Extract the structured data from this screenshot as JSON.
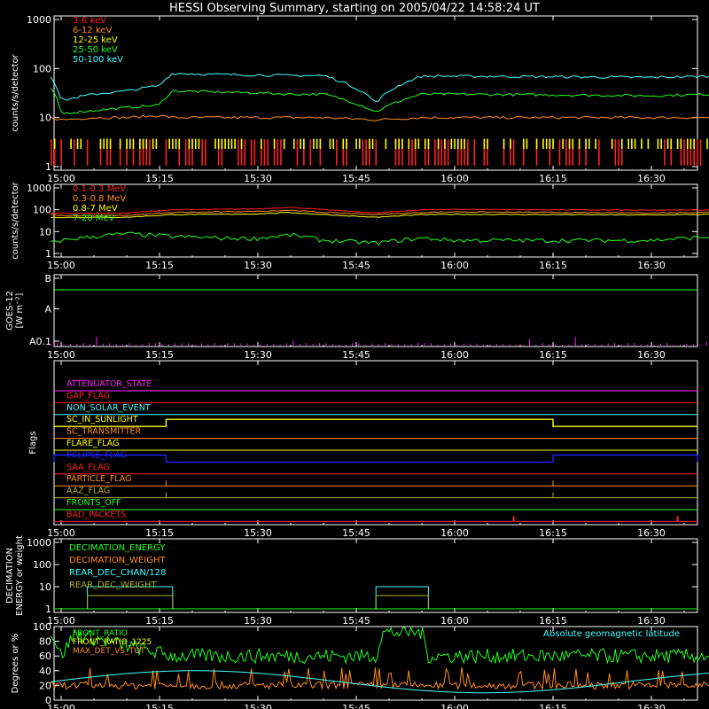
{
  "title": "HESSI Observing Summary, starting on 2005/04/22 14:58:24 UT",
  "time_ticks": [
    "15:00",
    "15:15",
    "15:30",
    "15:45",
    "16:00",
    "16:15",
    "16:30"
  ],
  "colors": {
    "red": "#ff2020",
    "orange": "#ff8c1a",
    "yellow": "#ffff00",
    "green": "#20ff20",
    "cyan": "#40ffff",
    "magenta": "#ff20ff",
    "blue": "#2020ff",
    "olive": "#b0b020",
    "axis": "#ffffff",
    "background": "#000000"
  },
  "chart_data": [
    {
      "id": "low-energy",
      "type": "line",
      "ylabel": "counts/s/detector",
      "scale": "log",
      "yticks": [
        "1",
        "10",
        "100",
        "1000"
      ],
      "legend_placement": "top-left",
      "x": [
        "14:58:24",
        "15:00",
        "15:05",
        "15:10",
        "15:15",
        "15:17",
        "15:25",
        "15:30",
        "15:35",
        "15:40",
        "15:48",
        "15:55",
        "16:00",
        "16:15",
        "16:30",
        "16:40"
      ],
      "series": [
        {
          "name": "3-6 keV",
          "color": "red",
          "values": [
            1.6,
            1.6,
            1.5,
            1.6,
            1.7,
            1.5,
            1.6,
            1.5,
            1.6,
            1.6,
            1.5,
            1.6,
            1.6,
            1.5,
            1.6,
            1.6
          ]
        },
        {
          "name": "6-12 keV",
          "color": "orange",
          "values": [
            10,
            9,
            10,
            10,
            11,
            10,
            10,
            10,
            10,
            10,
            9,
            10,
            10,
            10,
            10,
            10
          ]
        },
        {
          "name": "12-25 keV",
          "color": "yellow",
          "values": [
            3.5,
            3.3,
            3.4,
            3.5,
            3.6,
            3.4,
            3.4,
            3.4,
            3.5,
            3.4,
            3.3,
            3.4,
            3.4,
            3.4,
            3.4,
            3.5
          ]
        },
        {
          "name": "25-50 keV",
          "color": "green",
          "values": [
            40,
            12,
            14,
            16,
            18,
            35,
            33,
            32,
            30,
            30,
            13,
            30,
            30,
            29,
            28,
            30
          ]
        },
        {
          "name": "50-100 keV",
          "color": "cyan",
          "values": [
            70,
            22,
            30,
            35,
            45,
            80,
            75,
            74,
            72,
            72,
            20,
            70,
            70,
            68,
            66,
            70
          ]
        }
      ]
    },
    {
      "id": "high-energy",
      "type": "line",
      "ylabel": "counts/s/detector",
      "scale": "log",
      "yticks": [
        "1",
        "10",
        "100",
        "1000"
      ],
      "legend_placement": "top-left",
      "x": [
        "14:58:24",
        "15:00",
        "15:10",
        "15:17",
        "15:25",
        "15:30",
        "15:35",
        "15:40",
        "15:48",
        "15:55",
        "16:00",
        "16:15",
        "16:30",
        "16:40"
      ],
      "series": [
        {
          "name": "0.1-0.3 MeV",
          "color": "red",
          "values": [
            70,
            70,
            70,
            100,
            105,
            110,
            130,
            100,
            70,
            100,
            105,
            100,
            95,
            100
          ]
        },
        {
          "name": "0.3-0.8 MeV",
          "color": "orange",
          "values": [
            60,
            55,
            55,
            75,
            80,
            85,
            95,
            75,
            60,
            75,
            80,
            75,
            72,
            78
          ]
        },
        {
          "name": "0.8-7 MeV",
          "color": "yellow",
          "values": [
            45,
            45,
            45,
            60,
            62,
            65,
            75,
            60,
            45,
            60,
            62,
            60,
            58,
            62
          ]
        },
        {
          "name": "7-20 MeV",
          "color": "green",
          "values": [
            3,
            4,
            8,
            6,
            5,
            5,
            7,
            4,
            3,
            5,
            4,
            4,
            4,
            6
          ]
        }
      ]
    },
    {
      "id": "goes",
      "type": "line",
      "ylabel": "GOES-12\n[W m⁻²]",
      "yticks": [
        "A0.1",
        "A",
        "B"
      ],
      "series": [
        {
          "name": "",
          "color": "green",
          "values": [
            0.85,
            0.85
          ]
        },
        {
          "name": "",
          "color": "magenta",
          "values": [
            0.02,
            0.02
          ]
        }
      ]
    },
    {
      "id": "flags",
      "type": "line",
      "ylabel": "Flags",
      "labels": [
        {
          "name": "ATTENUATOR_STATE",
          "color": "magenta"
        },
        {
          "name": "GAP_FLAG",
          "color": "red"
        },
        {
          "name": "NON_SOLAR_EVENT",
          "color": "cyan"
        },
        {
          "name": "SC_IN_SUNLIGHT",
          "color": "yellow"
        },
        {
          "name": "SC_TRANSMITTER",
          "color": "orange"
        },
        {
          "name": "FLARE_FLAG",
          "color": "yellow"
        },
        {
          "name": "ECLIPSE_FLAG",
          "color": "blue"
        },
        {
          "name": "SAA_FLAG",
          "color": "red"
        },
        {
          "name": "PARTICLE_FLAG",
          "color": "orange"
        },
        {
          "name": "AAZ_FLAG",
          "color": "olive"
        },
        {
          "name": "FRONTS_OFF",
          "color": "green"
        },
        {
          "name": "BAD_PACKETS",
          "color": "red"
        }
      ],
      "intervals": {
        "SC_IN_SUNLIGHT": [
          [
            "15:16",
            "16:15"
          ]
        ],
        "ECLIPSE_FLAG": [
          [
            "14:58:24",
            "15:16"
          ],
          [
            "16:15",
            "16:40"
          ]
        ]
      }
    },
    {
      "id": "decimation",
      "type": "line",
      "ylabel": "DECIMATION\nENERGY or weight",
      "scale": "log",
      "yticks": [
        "1",
        "10",
        "100",
        "1000"
      ],
      "series": [
        {
          "name": "DECIMATION_ENERGY",
          "color": "green"
        },
        {
          "name": "DECIMATION_WEIGHT",
          "color": "orange"
        },
        {
          "name": "REAR_DEC_CHAN/128",
          "color": "cyan"
        },
        {
          "name": "REAR_DEC_WEIGHT",
          "color": "olive"
        }
      ],
      "blocks": [
        [
          "15:04",
          "15:17"
        ],
        [
          "15:48",
          "15:56"
        ]
      ]
    },
    {
      "id": "ratios",
      "type": "line",
      "ylabel": "Degrees or %",
      "yticks": [
        "0",
        "20",
        "40",
        "60",
        "80",
        "100"
      ],
      "ylim": [
        0,
        100
      ],
      "series": [
        {
          "name": "FRONT_RATIO",
          "color": "green"
        },
        {
          "name": "FRONT_RATIO_1225",
          "color": "yellow"
        },
        {
          "name": "MAX_DET_VS_TOT",
          "color": "orange"
        },
        {
          "name": "Absolute geomagnetic latitude",
          "color": "cyan"
        }
      ]
    }
  ]
}
